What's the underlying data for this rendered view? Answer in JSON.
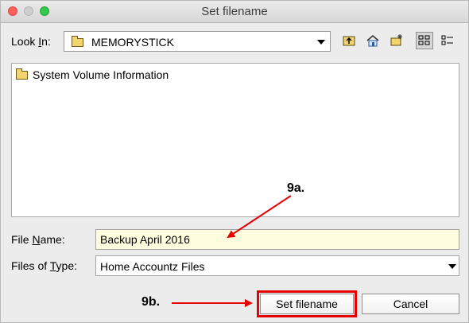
{
  "window": {
    "title": "Set filename",
    "controls": {
      "close": "close",
      "minimize": "minimize",
      "maximize": "maximize"
    }
  },
  "look_in": {
    "label_pre": "Look ",
    "label_mnemonic": "I",
    "label_post": "n:",
    "value": "MEMORYSTICK"
  },
  "toolbar": {
    "icons": [
      "up-folder-icon",
      "home-icon",
      "new-folder-icon",
      "list-view-icon",
      "details-view-icon"
    ]
  },
  "files": [
    {
      "name": "System Volume Information",
      "icon": "folder-icon"
    }
  ],
  "file_name": {
    "label_pre": "File ",
    "label_mnemonic": "N",
    "label_post": "ame:",
    "value": "Backup April 2016"
  },
  "files_of_type": {
    "label_pre": "Files of ",
    "label_mnemonic": "T",
    "label_post": "ype:",
    "value": "Home Accountz Files"
  },
  "buttons": {
    "set_filename": "Set filename",
    "cancel": "Cancel"
  },
  "annotations": {
    "a": "9a.",
    "b": "9b."
  },
  "colors": {
    "highlight": "#e60000",
    "input_bg": "#fffde0"
  }
}
